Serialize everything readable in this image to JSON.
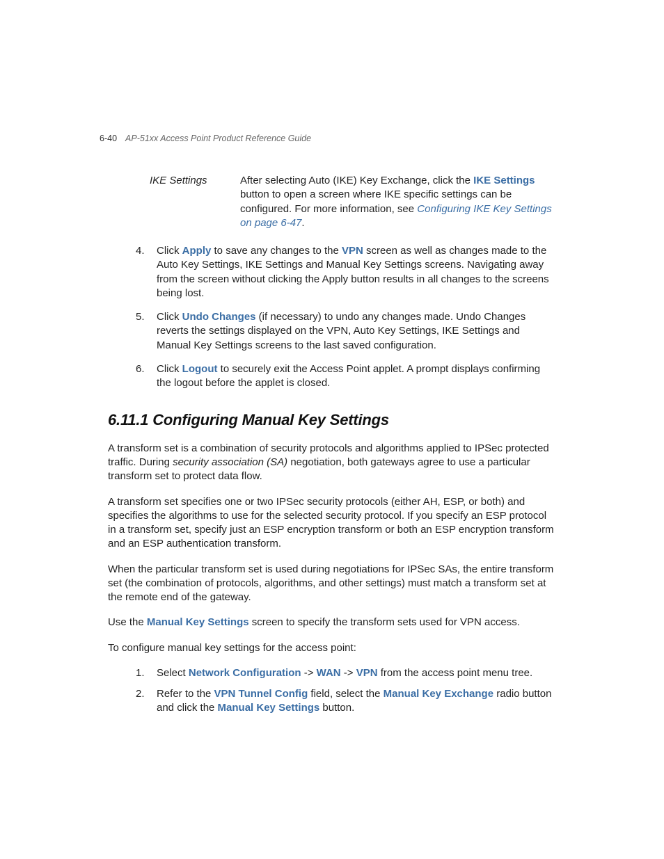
{
  "header": {
    "page_num": "6-40",
    "title": "AP-51xx Access Point Product Reference Guide"
  },
  "def": {
    "term": "IKE Settings",
    "pre": "After selecting Auto (IKE) Key Exchange, click the ",
    "bold1": "IKE Settings",
    "mid": " button to open a screen where IKE specific settings can be configured. For more information, see ",
    "link": "Configuring IKE Key Settings on page 6-47",
    "after": "."
  },
  "steps": {
    "s4a": "Click ",
    "s4b": "Apply",
    "s4c": " to save any changes to the ",
    "s4d": "VPN",
    "s4e": " screen as well as changes made to the Auto Key Settings, IKE Settings and Manual Key Settings screens. Navigating away from the screen without clicking the Apply button results in all changes to the screens being lost.",
    "s5a": "Click ",
    "s5b": "Undo Changes",
    "s5c": " (if necessary) to undo any changes made. Undo Changes reverts the settings displayed on the VPN, Auto Key Settings, IKE Settings and Manual Key Settings screens to the last saved configuration.",
    "s6a": "Click ",
    "s6b": "Logout",
    "s6c": " to securely exit the Access Point applet. A prompt displays confirming the logout before the applet is closed."
  },
  "section": {
    "heading": "6.11.1  Configuring Manual Key Settings",
    "p1a": "A transform set is a combination of security protocols and algorithms applied to IPSec protected traffic. During ",
    "p1b": "security association (SA)",
    "p1c": " negotiation, both gateways agree to use a particular transform set to protect data flow.",
    "p2": "A transform set specifies one or two IPSec security protocols (either AH, ESP, or both) and specifies the algorithms to use for the selected security protocol. If you specify an ESP protocol in a transform set, specify just an ESP encryption transform or both an ESP encryption transform and an ESP authentication transform.",
    "p3": "When the particular transform set is used during negotiations for IPSec SAs, the entire transform set (the combination of protocols, algorithms, and other settings) must match a transform set at the remote end of the gateway.",
    "p4a": "Use the ",
    "p4b": "Manual Key Settings",
    "p4c": " screen to specify the transform sets used for VPN access.",
    "p5": "To configure manual key settings for the access point:",
    "sub1a": "Select ",
    "sub1b": "Network Configuration",
    "sub1c": " -> ",
    "sub1d": "WAN",
    "sub1e": " -> ",
    "sub1f": "VPN",
    "sub1g": " from the access point menu tree.",
    "sub2a": "Refer to the ",
    "sub2b": "VPN Tunnel Config",
    "sub2c": " field, select the ",
    "sub2d": "Manual Key Exchange",
    "sub2e": " radio button and click the ",
    "sub2f": "Manual Key Settings",
    "sub2g": " button."
  }
}
